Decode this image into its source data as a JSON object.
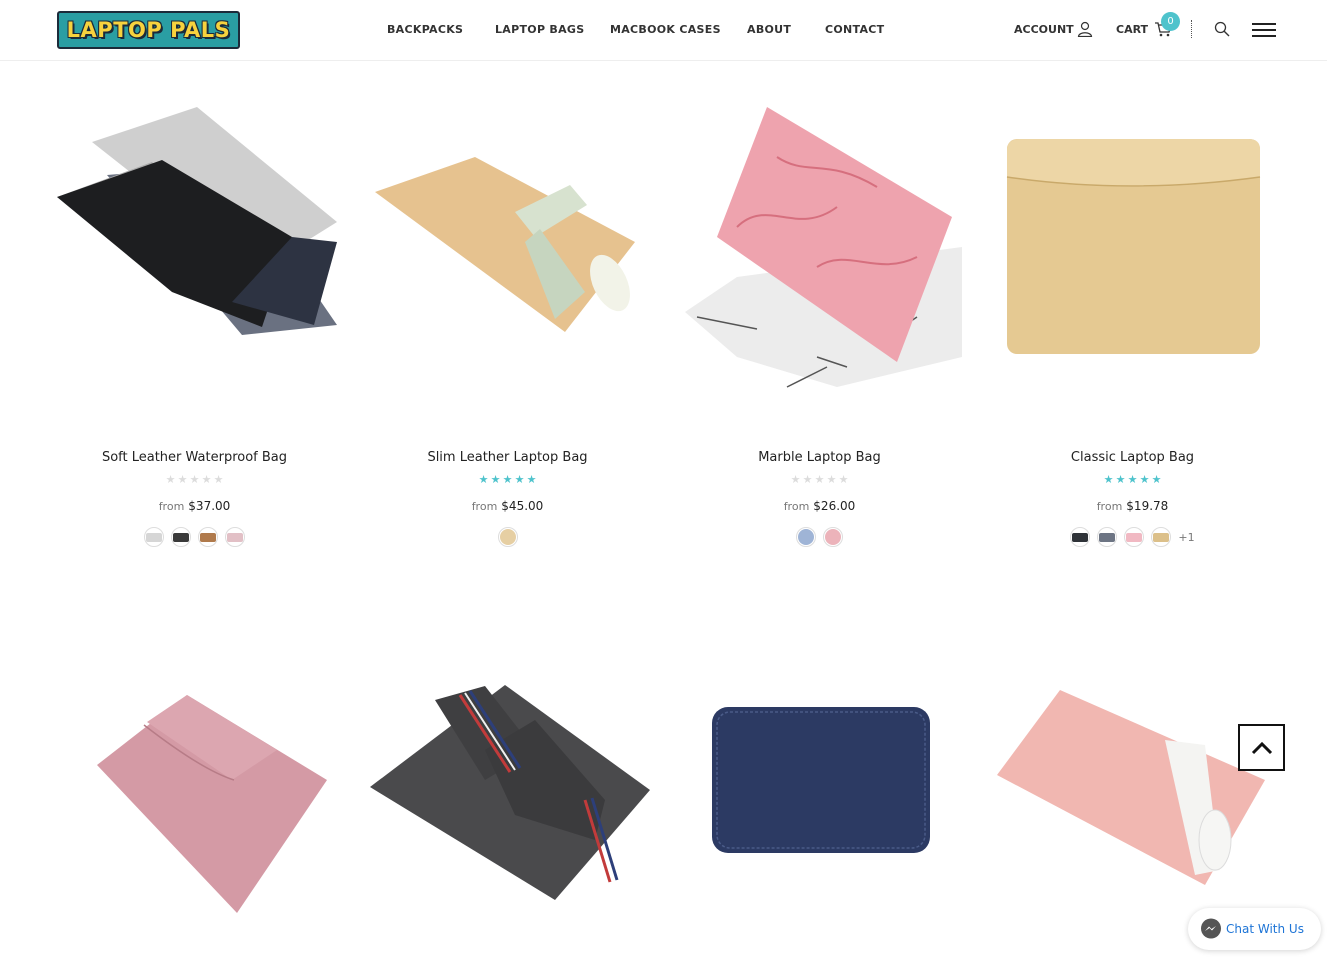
{
  "header": {
    "logo_text": "LAPTOP PALS",
    "nav": [
      {
        "label": "BACKPACKS"
      },
      {
        "label": "LAPTOP BAGS"
      },
      {
        "label": "MACBOOK CASES"
      },
      {
        "label": "ABOUT"
      },
      {
        "label": "CONTACT"
      }
    ],
    "account_label": "ACCOUNT",
    "cart_label": "CART",
    "cart_count": "0",
    "icons": [
      "user-icon",
      "cart-icon",
      "search-icon",
      "hamburger-menu-icon"
    ]
  },
  "products": [
    {
      "title": "Soft Leather Waterproof Bag",
      "rating": 0,
      "price_prefix": "from",
      "price": "$37.00",
      "swatches": [
        "#d6d6d6",
        "#3a3a3a",
        "#b07a4c",
        "#e2c0c6"
      ],
      "swatch_more": ""
    },
    {
      "title": "Slim Leather Laptop Bag",
      "rating": 5,
      "price_prefix": "from",
      "price": "$45.00",
      "swatches": [
        "#e6cfa3"
      ],
      "swatch_more": ""
    },
    {
      "title": "Marble Laptop Bag",
      "rating": 0,
      "price_prefix": "from",
      "price": "$26.00",
      "swatches": [
        "#9fb4d6",
        "#ecb3ba"
      ],
      "swatch_more": ""
    },
    {
      "title": "Classic Laptop Bag",
      "rating": 5,
      "price_prefix": "from",
      "price": "$19.78",
      "swatches": [
        "#2f3338",
        "#6d7584",
        "#f1b9c3",
        "#dcc08a"
      ],
      "swatch_more": "+1"
    },
    {
      "title": "",
      "rating": 0,
      "price_prefix": "",
      "price": "",
      "swatches": [],
      "swatch_more": ""
    },
    {
      "title": "",
      "rating": 0,
      "price_prefix": "",
      "price": "",
      "swatches": [],
      "swatch_more": ""
    },
    {
      "title": "",
      "rating": 0,
      "price_prefix": "",
      "price": "",
      "swatches": [],
      "swatch_more": ""
    },
    {
      "title": "",
      "rating": 0,
      "price_prefix": "",
      "price": "",
      "swatches": [],
      "swatch_more": ""
    }
  ],
  "colors": {
    "accent": "#4ec3cc",
    "star_filled": "#4ec3cc",
    "star_empty": "#dcdcdc"
  },
  "chat": {
    "label": "Chat With Us"
  }
}
